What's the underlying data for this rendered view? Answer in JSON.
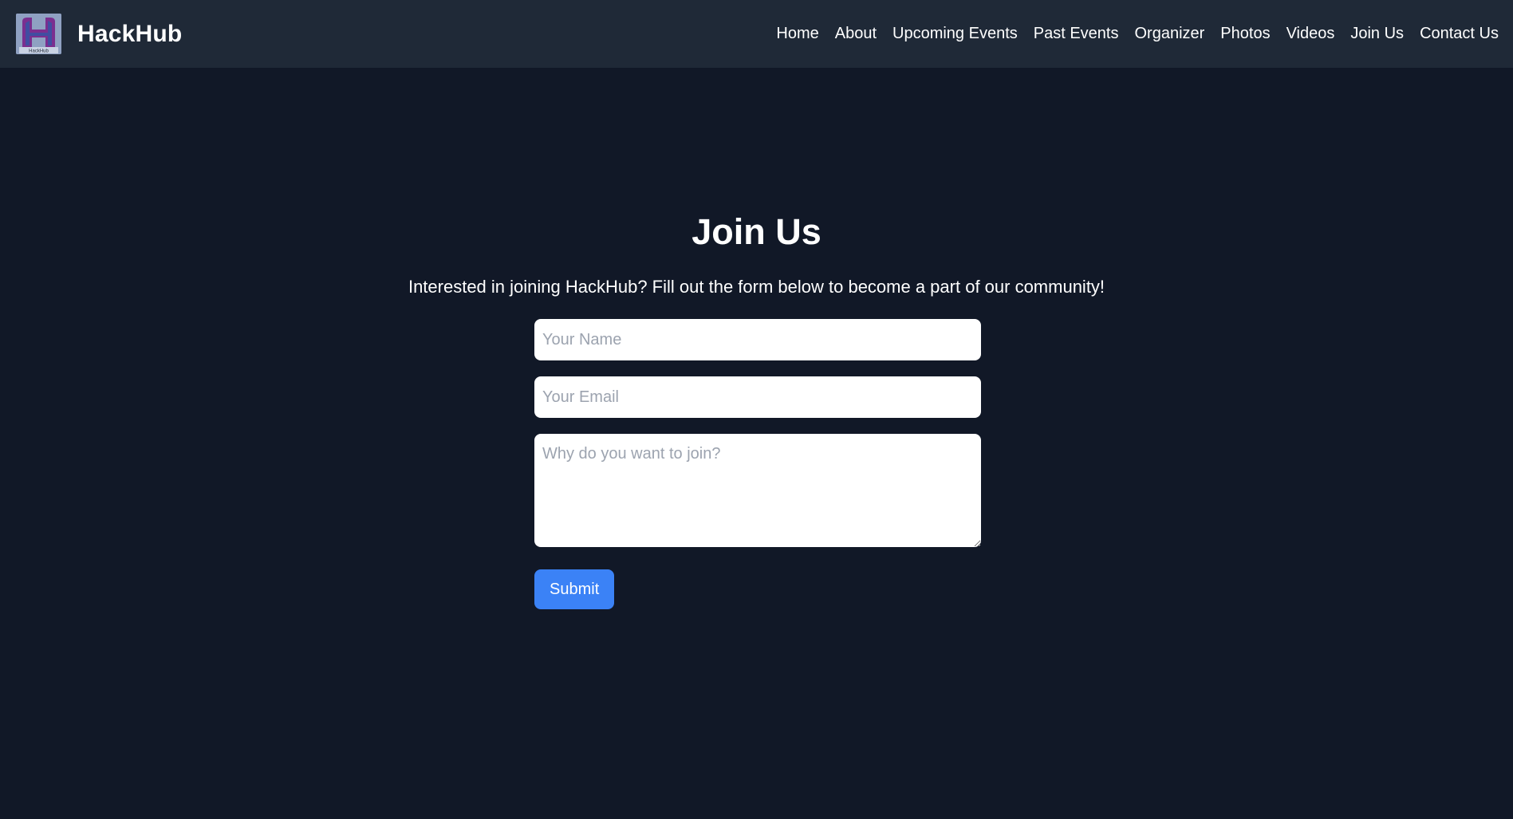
{
  "brand": {
    "name": "HackHub",
    "logo_text": "HackHub"
  },
  "nav": {
    "items": [
      {
        "label": "Home"
      },
      {
        "label": "About"
      },
      {
        "label": "Upcoming Events"
      },
      {
        "label": "Past Events"
      },
      {
        "label": "Organizer"
      },
      {
        "label": "Photos"
      },
      {
        "label": "Videos"
      },
      {
        "label": "Join Us"
      },
      {
        "label": "Contact Us"
      }
    ]
  },
  "page": {
    "title": "Join Us",
    "intro": "Interested in joining HackHub? Fill out the form below to become a part of our community!"
  },
  "form": {
    "name_placeholder": "Your Name",
    "name_value": "",
    "email_placeholder": "Your Email",
    "email_value": "",
    "reason_placeholder": "Why do you want to join?",
    "reason_value": "",
    "submit_label": "Submit"
  },
  "colors": {
    "page_background": "#111827",
    "navbar_background": "#1f2937",
    "accent": "#3b82f6",
    "text": "#ffffff"
  }
}
